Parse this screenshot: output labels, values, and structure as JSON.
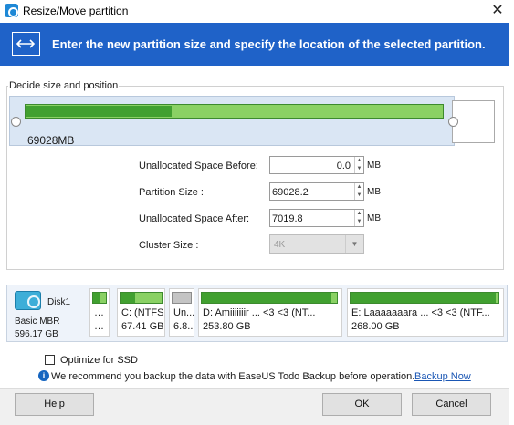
{
  "window": {
    "title": "Resize/Move partition",
    "close_glyph": "✕"
  },
  "banner": {
    "text": "Enter the new partition size and specify the location of the selected partition.",
    "icon": "resize-arrows-icon",
    "color": "#1f62c8"
  },
  "size_position": {
    "group_label": "Decide size and position",
    "bar_size_label": "69028MB",
    "used_fraction": 0.35,
    "fields": [
      {
        "label": "Unallocated Space Before:",
        "value": "0.0",
        "unit": "MB"
      },
      {
        "label": "Partition Size :",
        "value": "69028.2",
        "unit": "MB"
      },
      {
        "label": "Unallocated Space After:",
        "value": "7019.8",
        "unit": "MB"
      }
    ],
    "cluster": {
      "label": "Cluster Size :",
      "value": "4K"
    }
  },
  "disk_map": {
    "name": "Disk1",
    "type": "Basic MBR",
    "size": "596.17 GB",
    "partitions": [
      {
        "line1": "…",
        "line2": "…",
        "used_fraction": 0.5,
        "style": "green"
      },
      {
        "line1": "C: (NTFS",
        "line2": "67.41 GB",
        "used_fraction": 0.35,
        "style": "green"
      },
      {
        "line1": "Un...",
        "line2": "6.8...",
        "used_fraction": 1.0,
        "style": "gray"
      },
      {
        "line1": "D: Amiiiiiiir ... <3 <3 (NT...",
        "line2": "253.80 GB",
        "used_fraction": 0.96,
        "style": "green"
      },
      {
        "line1": "E: Laaaaaaara ... <3 <3 (NTF...",
        "line2": "268.00 GB",
        "used_fraction": 0.98,
        "style": "green"
      }
    ]
  },
  "options": {
    "optimize_ssd_label": "Optimize for SSD",
    "optimize_ssd_checked": false,
    "info_text": "We recommend you backup the data with EaseUS Todo Backup before operation.",
    "backup_link": "Backup Now"
  },
  "buttons": {
    "help": "Help",
    "ok": "OK",
    "cancel": "Cancel"
  }
}
